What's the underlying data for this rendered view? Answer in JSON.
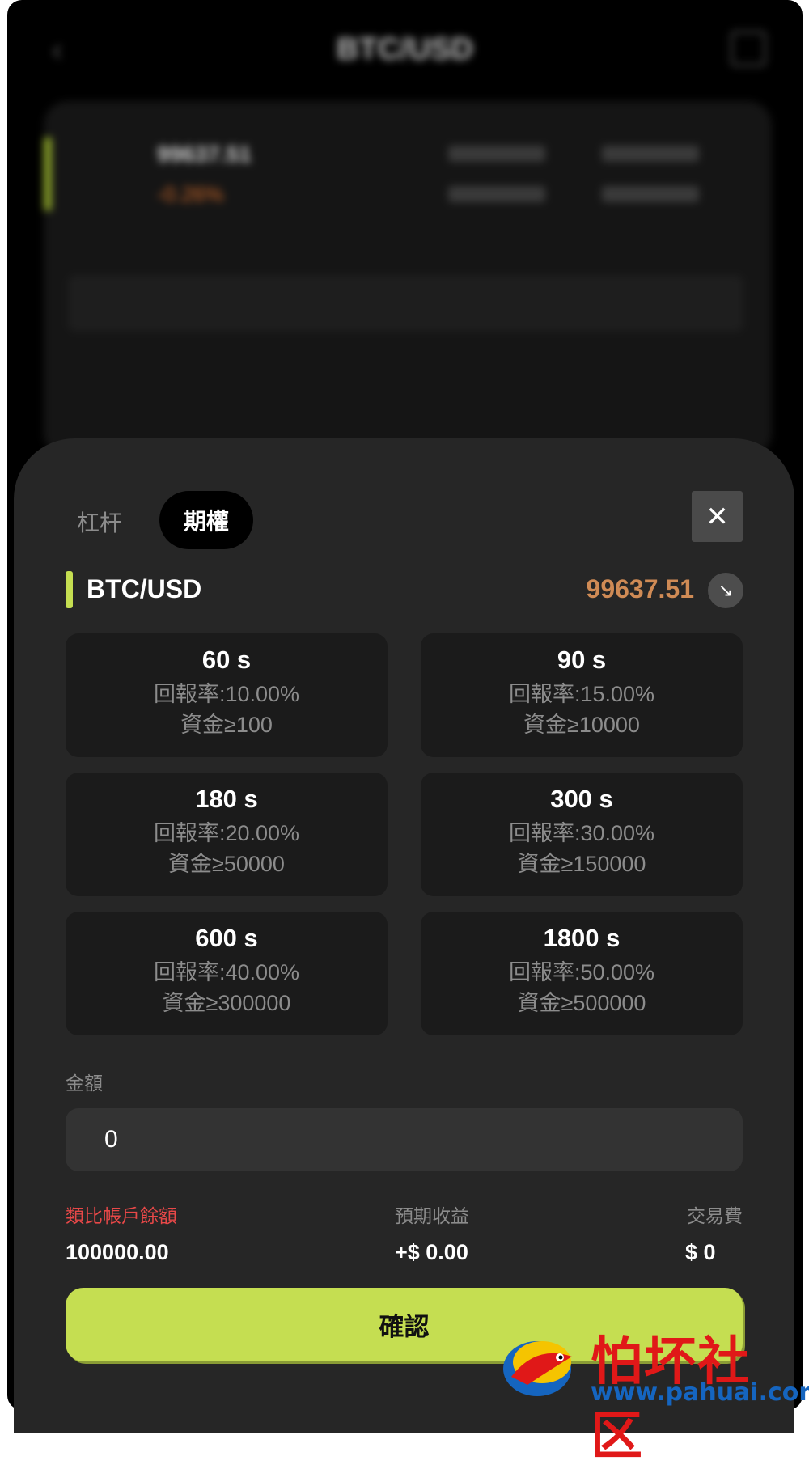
{
  "background": {
    "title": "BTC/USD",
    "price": "99637.51",
    "change": "-0.26%"
  },
  "sheet": {
    "tabs": [
      {
        "label": "杠杆",
        "active": false
      },
      {
        "label": "期權",
        "active": true
      }
    ],
    "close_icon": "close-icon",
    "symbol": "BTC/USD",
    "price": "99637.51",
    "trend_icon": "arrow-down-right-icon",
    "options": [
      {
        "duration": "60 s",
        "rate": "回報率:10.00%",
        "min": "資金≥100"
      },
      {
        "duration": "90 s",
        "rate": "回報率:15.00%",
        "min": "資金≥10000"
      },
      {
        "duration": "180 s",
        "rate": "回報率:20.00%",
        "min": "資金≥50000"
      },
      {
        "duration": "300 s",
        "rate": "回報率:30.00%",
        "min": "資金≥150000"
      },
      {
        "duration": "600 s",
        "rate": "回報率:40.00%",
        "min": "資金≥300000"
      },
      {
        "duration": "1800 s",
        "rate": "回報率:50.00%",
        "min": "資金≥500000"
      }
    ],
    "amount": {
      "label": "金額",
      "value": "0"
    },
    "stats": {
      "balance_label": "類比帳戶餘額",
      "balance_value": "100000.00",
      "expected_label": "預期收益",
      "expected_value": "+$ 0.00",
      "fee_label": "交易費",
      "fee_value": "$ 0"
    },
    "confirm_label": "確認"
  },
  "watermark": {
    "cn": "怕坏社区",
    "url": "www.pahuai.com"
  },
  "colors": {
    "accent": "#c5de51",
    "price": "#d08b55",
    "balance_label": "#e84848"
  }
}
